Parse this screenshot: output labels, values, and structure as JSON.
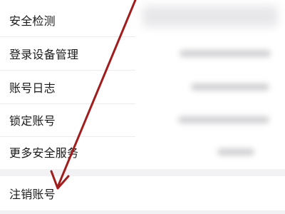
{
  "menu": {
    "items": [
      {
        "label": "安全检测"
      },
      {
        "label": "登录设备管理"
      },
      {
        "label": "账号日志"
      },
      {
        "label": "锁定账号"
      },
      {
        "label": "更多安全服务"
      }
    ],
    "delete_account_label": "注销账号"
  },
  "annotation": {
    "arrow_color": "#a31c1c"
  }
}
